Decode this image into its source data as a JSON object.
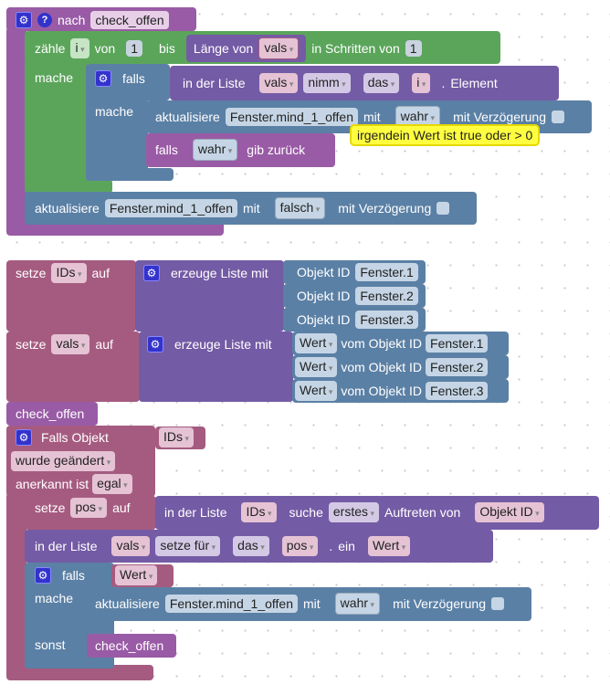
{
  "proc": {
    "label": "nach",
    "name": "check_offen"
  },
  "loop": {
    "count": "zähle",
    "var": "i",
    "from": "von",
    "from_val": "1",
    "to": "bis",
    "len": "Länge von",
    "list": "vals",
    "step": "in Schritten von",
    "step_val": "1",
    "do": "mache"
  },
  "if1": {
    "if": "falls",
    "do": "mache",
    "list_in": "in der Liste",
    "list": "vals",
    "op": "nimm",
    "which": "das",
    "idx": "i",
    "suffix": ".",
    "element": "Element"
  },
  "upd1": {
    "label": "aktualisiere",
    "obj": "Fenster.mind_1_offen",
    "with": "mit",
    "val": "wahr",
    "delay": "mit Verzögerung"
  },
  "ret": {
    "if": "falls",
    "val": "wahr",
    "label": "gib zurück"
  },
  "tooltip": "irgendein Wert ist true oder > 0",
  "upd2": {
    "label": "aktualisiere",
    "obj": "Fenster.mind_1_offen",
    "with": "mit",
    "val": "falsch",
    "delay": "mit Verzögerung"
  },
  "set_ids": {
    "set": "setze",
    "var": "IDs",
    "to": "auf",
    "create": "erzeuge Liste mit",
    "obj_label": "Objekt ID",
    "items": [
      "Fenster.1",
      "Fenster.2",
      "Fenster.3"
    ]
  },
  "set_vals": {
    "set": "setze",
    "var": "vals",
    "to": "auf",
    "create": "erzeuge Liste mit",
    "prop": "Wert",
    "from": "vom Objekt ID",
    "items": [
      "Fenster.1",
      "Fenster.2",
      "Fenster.3"
    ]
  },
  "call1": "check_offen",
  "event": {
    "label": "Falls Objekt",
    "ids": "IDs",
    "changed": "wurde geändert",
    "ack": "anerkannt ist",
    "ack_val": "egal"
  },
  "set_pos": {
    "set": "setze",
    "var": "pos",
    "to": "auf",
    "list_in": "in der Liste",
    "list": "IDs",
    "find": "suche",
    "which": "erstes",
    "occ": "Auftreten von",
    "item": "Objekt ID"
  },
  "set_list": {
    "list_in": "in der Liste",
    "list": "vals",
    "op": "setze für",
    "which": "das",
    "idx": "pos",
    "suffix": ".",
    "ein": "ein",
    "val": "Wert"
  },
  "if2": {
    "if": "falls",
    "cond": "Wert",
    "do": "mache",
    "else": "sonst"
  },
  "upd3": {
    "label": "aktualisiere",
    "obj": "Fenster.mind_1_offen",
    "with": "mit",
    "val": "wahr",
    "delay": "mit Verzögerung"
  },
  "call2": "check_offen",
  "colors": {
    "procedure": "#995ba5",
    "loop": "#5ba55b",
    "iobroker": "#5b80a5",
    "list": "#745ba5",
    "variable": "#a55b80",
    "tooltip": "#ffff40"
  }
}
